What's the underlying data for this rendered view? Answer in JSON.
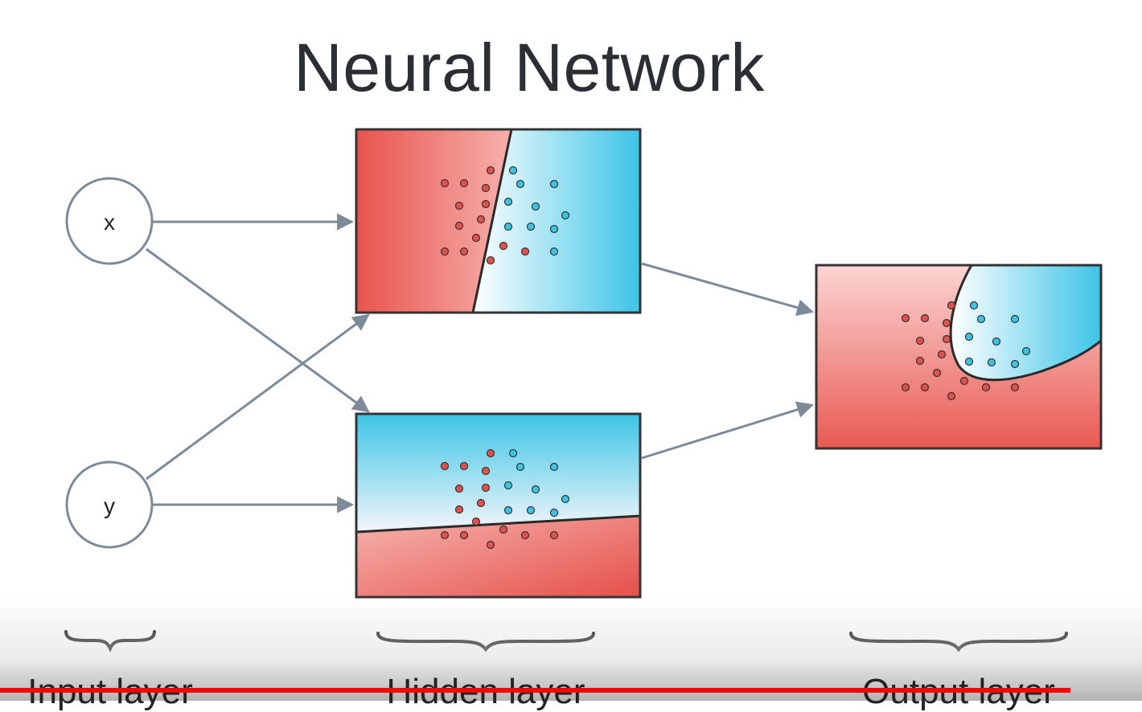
{
  "title": "Neural Network",
  "input_nodes": [
    {
      "label": "x"
    },
    {
      "label": "y"
    }
  ],
  "layer_labels": {
    "input": "Input layer",
    "hidden": "Hidden layer",
    "output": "Output layer"
  },
  "colors": {
    "red_class": "#e2514c",
    "blue_class": "#3cc3e6",
    "edge": "#7d8a99",
    "node_stroke": "#7d8a99",
    "box_stroke": "#333333",
    "progress": "#ff0000"
  },
  "video": {
    "progress_fraction": 0.937
  }
}
